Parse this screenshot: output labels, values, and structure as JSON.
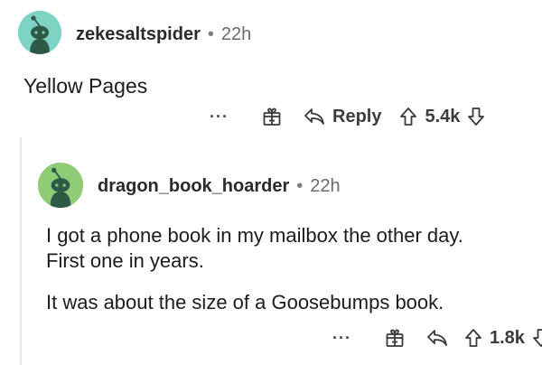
{
  "comments": [
    {
      "username": "zekesaltspider",
      "separator": "•",
      "time": "22h",
      "lines": [
        "Yellow Pages"
      ],
      "actions": {
        "more": "···",
        "reply": "Reply",
        "score": "5.4k"
      },
      "avatar_color": "#7fd3c4"
    },
    {
      "username": "dragon_book_hoarder",
      "separator": "•",
      "time": "22h",
      "lines": [
        "I got a phone book in my mailbox the other day.",
        "First one in years.",
        "It was about the size of a Goosebumps book."
      ],
      "actions": {
        "more": "···",
        "score": "1.8k"
      },
      "avatar_color": "#90cc76"
    }
  ],
  "colors": {
    "text": "#1c1c1c",
    "meta": "#6a6a6a",
    "thread_line": "#e8e8e8",
    "snoo": "#2d5a46"
  }
}
